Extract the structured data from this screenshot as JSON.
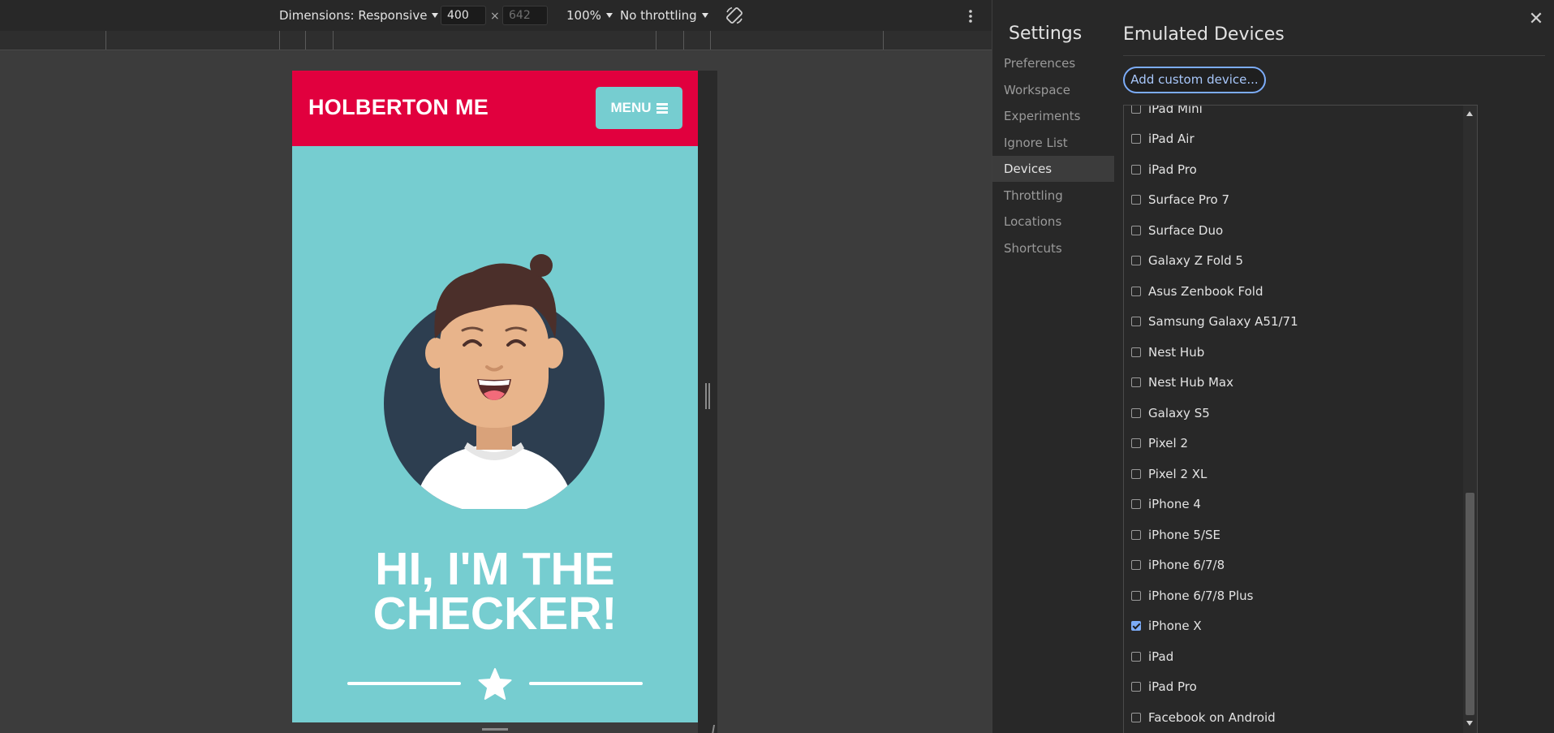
{
  "toolbar": {
    "dimensions_label": "Dimensions: Responsive",
    "width_value": "400",
    "times_sign": "×",
    "height_placeholder": "642",
    "zoom": "100%",
    "throttling": "No throttling",
    "rotate_icon": "rotate-icon",
    "more_icon": "more-vert-icon"
  },
  "site": {
    "logo": "HOLBERTON ME",
    "menu_label": "MENU",
    "hero_line1": "HI, I'M THE",
    "hero_line2": "CHECKER!",
    "divider_icon": "star-icon"
  },
  "settings": {
    "title": "Settings",
    "nav": [
      "Preferences",
      "Workspace",
      "Experiments",
      "Ignore List",
      "Devices",
      "Throttling",
      "Locations",
      "Shortcuts"
    ],
    "active_nav": "Devices",
    "close_icon": "close-icon"
  },
  "emulated_devices": {
    "title": "Emulated Devices",
    "add_button": "Add custom device...",
    "devices": [
      {
        "name": "iPad Mini",
        "checked": false
      },
      {
        "name": "iPad Air",
        "checked": false
      },
      {
        "name": "iPad Pro",
        "checked": false
      },
      {
        "name": "Surface Pro 7",
        "checked": false
      },
      {
        "name": "Surface Duo",
        "checked": false
      },
      {
        "name": "Galaxy Z Fold 5",
        "checked": false
      },
      {
        "name": "Asus Zenbook Fold",
        "checked": false
      },
      {
        "name": "Samsung Galaxy A51/71",
        "checked": false
      },
      {
        "name": "Nest Hub",
        "checked": false
      },
      {
        "name": "Nest Hub Max",
        "checked": false
      },
      {
        "name": "Galaxy S5",
        "checked": false
      },
      {
        "name": "Pixel 2",
        "checked": false
      },
      {
        "name": "Pixel 2 XL",
        "checked": false
      },
      {
        "name": "iPhone 4",
        "checked": false
      },
      {
        "name": "iPhone 5/SE",
        "checked": false
      },
      {
        "name": "iPhone 6/7/8",
        "checked": false
      },
      {
        "name": "iPhone 6/7/8 Plus",
        "checked": false
      },
      {
        "name": "iPhone X",
        "checked": true
      },
      {
        "name": "iPad",
        "checked": false
      },
      {
        "name": "iPad Pro",
        "checked": false
      },
      {
        "name": "Facebook on Android",
        "checked": false
      }
    ]
  },
  "colors": {
    "site_header": "#e1003e",
    "site_background": "#76cdd0",
    "accent": "#7cacf8"
  }
}
